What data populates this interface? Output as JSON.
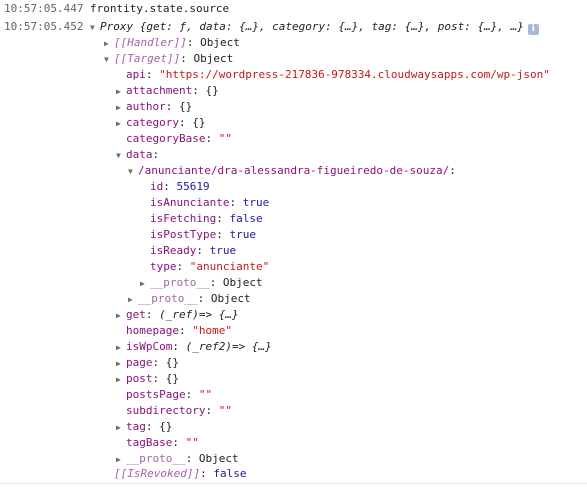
{
  "log1": {
    "timestamp": "10:57:05.447",
    "message": "frontity.state.source"
  },
  "log2": {
    "timestamp": "10:57:05.452",
    "preview": "Proxy {get: ƒ, data: {…}, category: {…}, tag: {…}, post: {…}, …}",
    "info_icon": "i"
  },
  "tree": {
    "handler": {
      "key": "[[Handler]]",
      "value": "Object"
    },
    "target": {
      "key": "[[Target]]",
      "value": "Object"
    },
    "api": {
      "key": "api",
      "value": "\"https://wordpress-217836-978334.cloudwaysapps.com/wp-json\""
    },
    "attachment": {
      "key": "attachment",
      "value": "{}"
    },
    "author": {
      "key": "author",
      "value": "{}"
    },
    "category": {
      "key": "category",
      "value": "{}"
    },
    "categoryBase": {
      "key": "categoryBase",
      "value": "\"\""
    },
    "data": {
      "key": "data",
      "value": ""
    },
    "route": {
      "key": "/anunciante/dra-alessandra-figueiredo-de-souza/",
      "value": ""
    },
    "id": {
      "key": "id",
      "value": "55619"
    },
    "isAnunciante": {
      "key": "isAnunciante",
      "value": "true"
    },
    "isFetching": {
      "key": "isFetching",
      "value": "false"
    },
    "isPostType": {
      "key": "isPostType",
      "value": "true"
    },
    "isReady": {
      "key": "isReady",
      "value": "true"
    },
    "type": {
      "key": "type",
      "value": "\"anunciante\""
    },
    "proto_route": {
      "key": "__proto__",
      "value": "Object"
    },
    "proto_data": {
      "key": "__proto__",
      "value": "Object"
    },
    "get": {
      "key": "get",
      "value": "(_ref)=> {…}"
    },
    "homepage": {
      "key": "homepage",
      "value": "\"home\""
    },
    "isWpCom": {
      "key": "isWpCom",
      "value": "(_ref2)=> {…}"
    },
    "page": {
      "key": "page",
      "value": "{}"
    },
    "post": {
      "key": "post",
      "value": "{}"
    },
    "postsPage": {
      "key": "postsPage",
      "value": "\"\""
    },
    "subdirectory": {
      "key": "subdirectory",
      "value": "\"\""
    },
    "tag": {
      "key": "tag",
      "value": "{}"
    },
    "tagBase": {
      "key": "tagBase",
      "value": "\"\""
    },
    "proto_target": {
      "key": "__proto__",
      "value": "Object"
    },
    "isRevoked": {
      "key": "[[IsRevoked]]",
      "value": "false"
    }
  },
  "colors": {
    "key": "#881280",
    "string": "#c41a16",
    "number": "#1a1aa6",
    "timestamp": "#5f6368"
  }
}
